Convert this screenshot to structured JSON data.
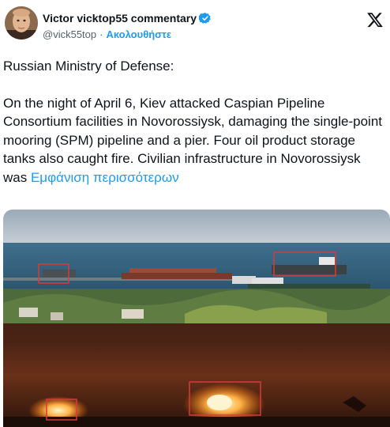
{
  "author": {
    "display_name": "Victor vicktop55 commentary",
    "handle": "@vick55top",
    "separator": "·",
    "follow_label": "Ακολουθήστε",
    "verified_color": "#1d9bf0",
    "avatar_icon": "avatar-icon"
  },
  "brand": {
    "logo_icon": "x-logo-icon"
  },
  "tweet": {
    "line1": "Russian Ministry of Defense:",
    "body": "On the night of April 6, Kiev attacked Caspian Pipeline Consortium facilities in Novorossiysk, damaging the single-point mooring (SPM) pipeline and a pier. Four oil product storage tanks also caught fire. Civilian infrastructure in Novorossiysk was ",
    "show_more_label": "Εμφάνιση περισσότερων"
  },
  "media": {
    "photo_top": "harbor-photo",
    "photo_bottom": "fire-night-photo",
    "highlight_color": "#d83a3a"
  },
  "colors": {
    "accent": "#1d9bf0",
    "text": "#0f1419",
    "muted": "#536471"
  }
}
